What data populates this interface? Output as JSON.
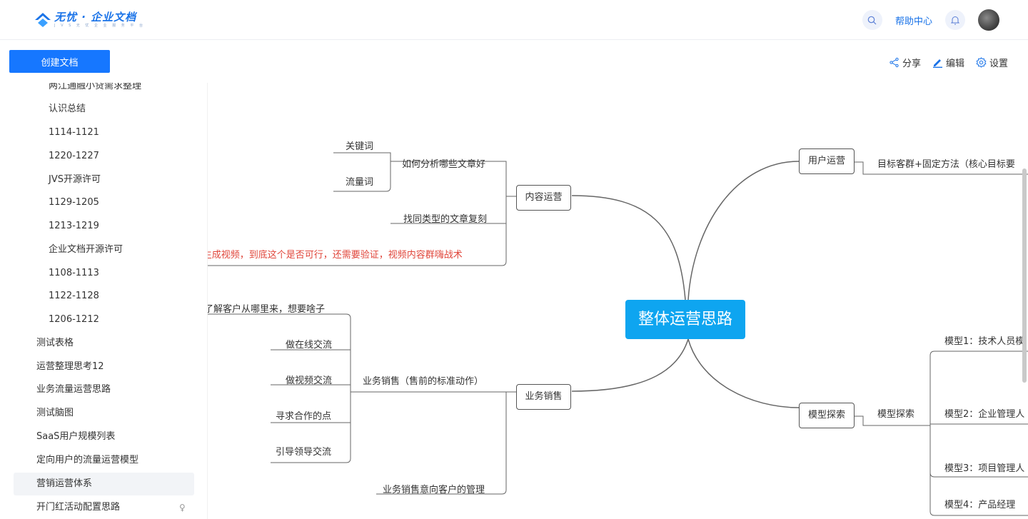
{
  "header": {
    "logo_title": "无忧 · 企业文档",
    "logo_sub": "J V S 无 忧 企 业 服 务 平 台",
    "help_label": "帮助中心",
    "search_icon": "search-icon",
    "bell_icon": "bell-icon"
  },
  "sidebar": {
    "create_label": "创建文档",
    "items": [
      {
        "label": "两江通融小贷需求整理"
      },
      {
        "label": "认识总结"
      },
      {
        "label": "1114-1121"
      },
      {
        "label": "1220-1227"
      },
      {
        "label": "JVS开源许可"
      },
      {
        "label": "1129-1205"
      },
      {
        "label": "1213-1219"
      },
      {
        "label": "企业文档开源许可"
      },
      {
        "label": "1108-1113"
      },
      {
        "label": "1122-1128"
      },
      {
        "label": "1206-1212"
      },
      {
        "label": "测试表格"
      },
      {
        "label": "运营整理思考12"
      },
      {
        "label": "业务流量运营思路"
      },
      {
        "label": "测试脑图"
      },
      {
        "label": "SaaS用户规模列表"
      },
      {
        "label": "定向用户的流量运营模型"
      },
      {
        "label": "营销运营体系"
      },
      {
        "label": "开门红活动配置思路"
      }
    ]
  },
  "toolbar": {
    "share_label": "分享",
    "edit_label": "编辑",
    "settings_label": "设置"
  },
  "mindmap": {
    "root": "整体运营思路",
    "content_ops": "内容运营",
    "analyze": "如何分析哪些文章好",
    "keyword": "关键词",
    "traffic_word": "流量词",
    "copy_articles": "找同类型的文章复刻",
    "video_note": "AI生成视频，到底这个是否可行，还需要验证，视频内容群嗨战术",
    "user_ops": "用户运营",
    "target_group": "目标客群+固定方法（核心目标要",
    "biz_sales": "业务销售",
    "biz_std": "业务销售（售前的标准动作）",
    "know_customer": "了解客户从哪里来，想要啥子",
    "online": "做在线交流",
    "video_chat": "做视频交流",
    "coop_point": "寻求合作的点",
    "guide_leader": "引导领导交流",
    "intent_mgmt": "业务销售意向客户的管理",
    "model_explore": "模型探索",
    "model_explore2": "模型探索",
    "model1": "模型1：技术人员模",
    "model2": "模型2：企业管理人",
    "model3": "模型3：项目管理人",
    "model4": "模型4：产品经理"
  }
}
